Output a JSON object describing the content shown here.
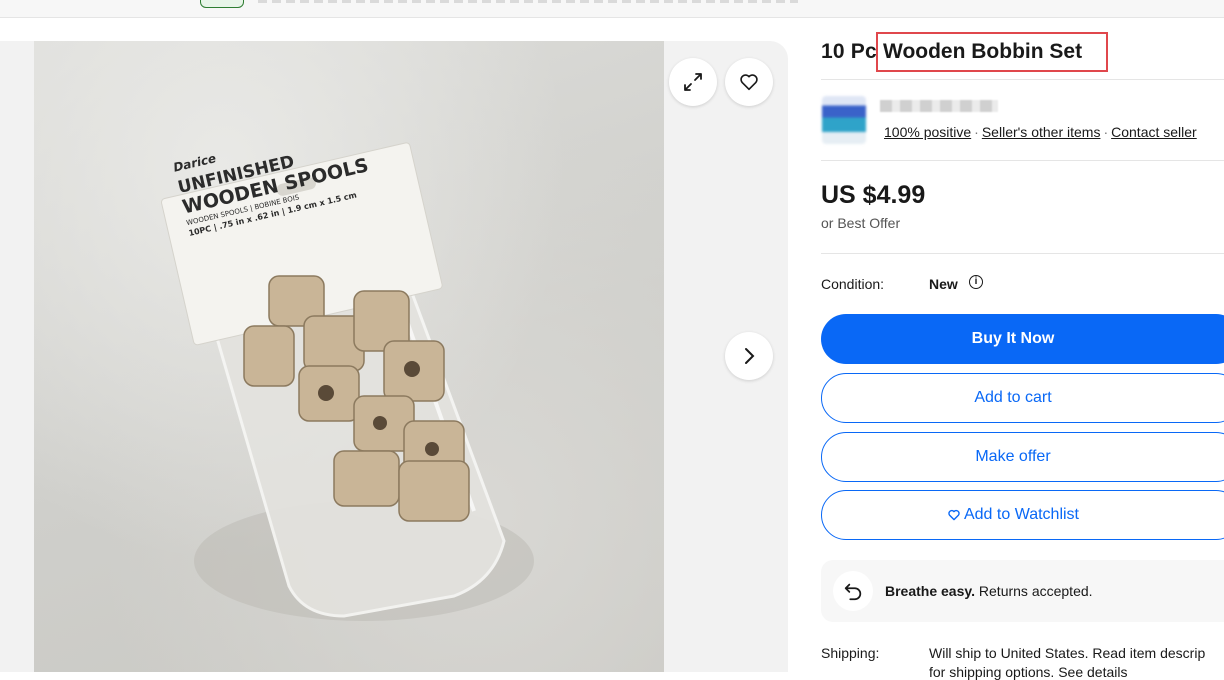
{
  "listing": {
    "title_prefix": "10 Pc",
    "title_highlight": "Wooden Bobbin Set",
    "price": "US $4.99",
    "best_offer": "or Best Offer",
    "condition_label": "Condition:",
    "condition_value": "New"
  },
  "seller": {
    "feedback": "100% positive",
    "other_items": "Seller's other items",
    "contact": "Contact seller"
  },
  "product_photo": {
    "brand": "Darice",
    "line1": "UNFINISHED",
    "line2": "WOODEN SPOOLS",
    "sub": "WOODEN SPOOLS | BOBINE BOIS",
    "size": "10PC | .75 in x .62 in | 1.9 cm x 1.5 cm"
  },
  "actions": {
    "buy_now": "Buy It Now",
    "add_to_cart": "Add to cart",
    "make_offer": "Make offer",
    "add_watchlist": "Add to Watchlist"
  },
  "returns": {
    "bold": "Breathe easy.",
    "text": "Returns accepted."
  },
  "shipping": {
    "label": "Shipping:",
    "text": "Will ship to United States. Read item descrip",
    "text2": "for shipping options. See details"
  },
  "icons": {
    "expand": "expand-icon",
    "heart": "heart-icon",
    "next": "chevron-right-icon",
    "info": "info-icon",
    "return": "return-arrow-icon"
  },
  "colors": {
    "accent": "#0968f6",
    "highlight_border": "#e0474c"
  }
}
